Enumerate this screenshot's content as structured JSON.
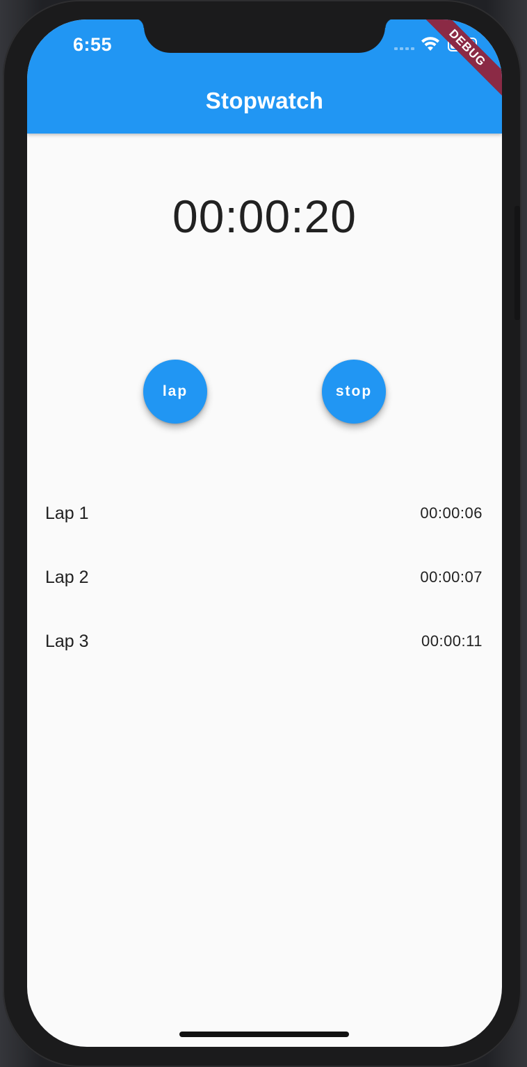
{
  "status_bar": {
    "time": "6:55",
    "debug_banner": "DEBUG"
  },
  "appbar": {
    "title": "Stopwatch",
    "color": "#2196f3"
  },
  "timer": {
    "display": "00:00:20"
  },
  "buttons": {
    "lap_label": "lap",
    "stop_label": "stop"
  },
  "laps": [
    {
      "label": "Lap 1",
      "time": "00:00:06"
    },
    {
      "label": "Lap 2",
      "time": "00:00:07"
    },
    {
      "label": "Lap 3",
      "time": "00:00:11"
    }
  ],
  "icons": {
    "wifi": "wifi-icon",
    "battery": "battery-icon",
    "signal": "cellular-signal-icon"
  }
}
